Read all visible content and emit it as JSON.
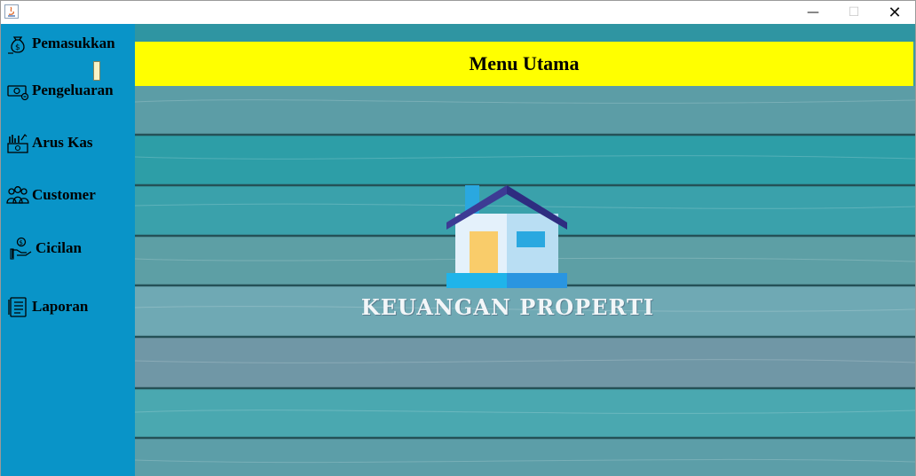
{
  "window": {
    "title": ""
  },
  "titlebar": {
    "minimize": "—",
    "maximize": "☐",
    "close": "✕"
  },
  "sidebar": {
    "items": [
      {
        "label": "Pemasukkan",
        "icon": "money-bag-icon"
      },
      {
        "label": "Pengeluaran",
        "icon": "cash-out-icon"
      },
      {
        "label": "Arus Kas",
        "icon": "cash-flow-icon"
      },
      {
        "label": "Customer",
        "icon": "customers-icon"
      },
      {
        "label": "Cicilan",
        "icon": "installment-icon"
      },
      {
        "label": "Laporan",
        "icon": "report-icon"
      }
    ]
  },
  "main": {
    "header": "Menu Utama",
    "brand_text": "KEUANGAN PROPERTI",
    "logo_icon": "house-icon"
  },
  "colors": {
    "sidebar": "#0994c8",
    "header": "#ffff00",
    "wood": "#3a99a3"
  }
}
